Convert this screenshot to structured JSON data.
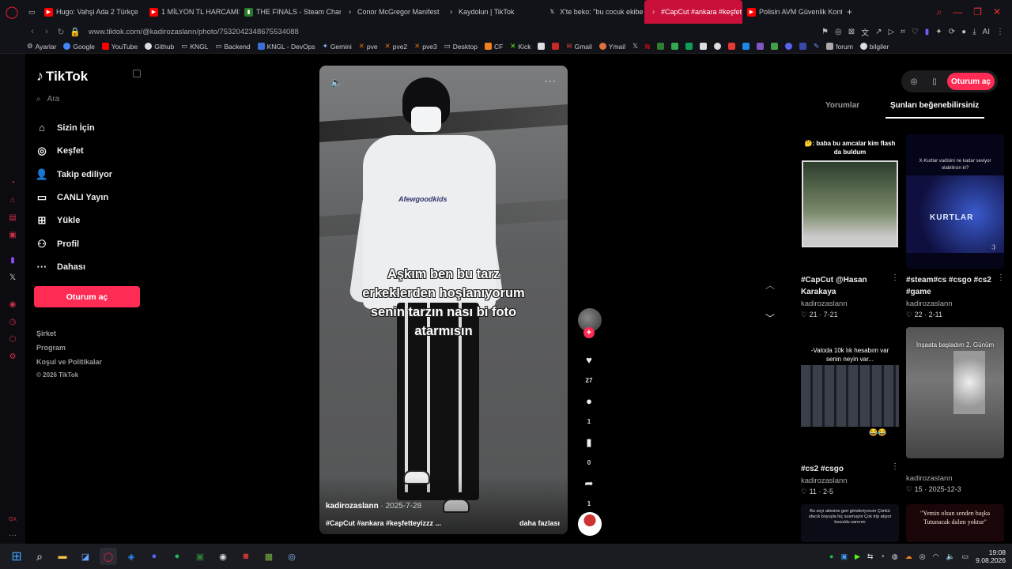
{
  "tabs": [
    {
      "label": "Hugo: Vahşi Ada 2 Türkçe",
      "color": "#ff0000",
      "icon": "youtube-icon"
    },
    {
      "label": "1 MİLYON TL HARCAMIŞ O",
      "color": "#ff0000",
      "icon": "youtube-icon"
    },
    {
      "label": "THE FINALS - Steam Char",
      "color": "#66c0f4",
      "icon": "chart-icon"
    },
    {
      "label": "Conor McGregor Manifest",
      "color": "#ffffff",
      "icon": "tiktok-icon"
    },
    {
      "label": "Kaydolun | TikTok",
      "color": "#ffffff",
      "icon": "tiktok-icon"
    },
    {
      "label": "X'te beko: \"bu cocuk ekibe",
      "color": "#ffffff",
      "icon": "x-icon"
    },
    {
      "label": "#CapCut #ankara #keşfet",
      "color": "#ffffff",
      "icon": "tiktok-icon",
      "active": true
    },
    {
      "label": "Polisin AVM Güvenlik Kont",
      "color": "#ff0000",
      "icon": "youtube-icon"
    }
  ],
  "address": {
    "url": "www.tiktok.com/@kadirozaslann/photo/7532042348675534088"
  },
  "ext_labels": {
    "ai": "AI"
  },
  "bookmarks": [
    {
      "label": "Ayarlar",
      "color": "#888"
    },
    {
      "label": "Google",
      "color": "#4285f4"
    },
    {
      "label": "YouTube",
      "color": "#ff0000"
    },
    {
      "label": "Github",
      "color": "#ddd"
    },
    {
      "label": "KNGL",
      "color": "#aaa"
    },
    {
      "label": "Backend",
      "color": "#aaa"
    },
    {
      "label": "KNGL - DevOps",
      "color": "#3b6fd8"
    },
    {
      "label": "Gemini",
      "color": "#8ab4f8"
    },
    {
      "label": "pve",
      "color": "#e57000"
    },
    {
      "label": "pve2",
      "color": "#e57000"
    },
    {
      "label": "pve3",
      "color": "#e57000"
    },
    {
      "label": "Desktop",
      "color": "#aaa"
    },
    {
      "label": "CF",
      "color": "#f38020"
    },
    {
      "label": "Kick",
      "color": "#53fc18"
    },
    {
      "label": "Gmail",
      "color": "#ea4335"
    },
    {
      "label": "Ymail",
      "color": "#e07040"
    },
    {
      "label": "forum",
      "color": "#aaa"
    },
    {
      "label": "bilgiler",
      "color": "#ddd"
    }
  ],
  "tiktok": {
    "logo": "TikTok",
    "search_placeholder": "Ara",
    "nav": [
      {
        "label": "Sizin İçin",
        "icon": "home-icon"
      },
      {
        "label": "Keşfet",
        "icon": "compass-icon"
      },
      {
        "label": "Takip ediliyor",
        "icon": "following-icon"
      },
      {
        "label": "CANLI Yayın",
        "icon": "live-icon"
      },
      {
        "label": "Yükle",
        "icon": "upload-icon"
      },
      {
        "label": "Profil",
        "icon": "profile-icon"
      },
      {
        "label": "Dahası",
        "icon": "more-icon"
      }
    ],
    "login": "Oturum aç",
    "footer": [
      "Şirket",
      "Program",
      "Koşul ve Politikalar",
      "© 2026 TikTok"
    ]
  },
  "video": {
    "caption_lines": [
      "Aşkım ben bu tarz",
      "erkeklerden hoşlanıyorum",
      "senin tarzın nası bi foto",
      "atarmısın"
    ],
    "shirt_text": "Afewgoodkids",
    "author": "kadirozaslann",
    "date": "· 2025-7-28",
    "tags": "#CapCut #ankara #keşfetteyizzz ...",
    "more": "daha fazlası",
    "likes": "27",
    "comments": "1",
    "saves": "0",
    "shares": "1"
  },
  "right": {
    "login": "Oturum aç",
    "tab_comments": "Yorumlar",
    "tab_like": "Şunları beğenebilirsiniz",
    "cards": [
      {
        "title_top": "🤔: baba bu amcalar kim flash da buldum",
        "caption": "#CapCut @Hasan Karakaya",
        "user": "kadirozaslann",
        "likes": "21",
        "date": "7-21"
      },
      {
        "title_top": "X-Kurtlar vadisini ne kadar seviyor olabilirsin ki?",
        "logo": "KURTLAR",
        "tail": ":)",
        "caption": "#steam#cs #csgo #cs2 #game",
        "user": "kadirozaslann",
        "likes": "22",
        "date": "2-11"
      },
      {
        "title_top": "-Valoda 10k lık hesabım var senin neyin var...",
        "emoji": "😂😂",
        "caption": "#cs2 #csgo",
        "user": "kadirozaslann",
        "likes": "11",
        "date": "2-5"
      },
      {
        "title_top": "İnşaata başladım 2. Günüm",
        "user": "kadirozaslann",
        "likes": "15",
        "date": "2025-12-3"
      },
      {
        "title_top": "Bu seyi ailesine geri gönderiyorum Çünkü ufacık boyuyla hiç susmuyor Çok trip atıyor bozuldu sanırım"
      },
      {
        "title_top": "\"Yemin olsun senden başka Tutunacak dalım yoktur\""
      }
    ]
  },
  "taskbar": {
    "time": "19:08",
    "date": "9.08.2026"
  },
  "colors": {
    "accent": "#fe2c55",
    "opera": "#ff1b3c"
  }
}
